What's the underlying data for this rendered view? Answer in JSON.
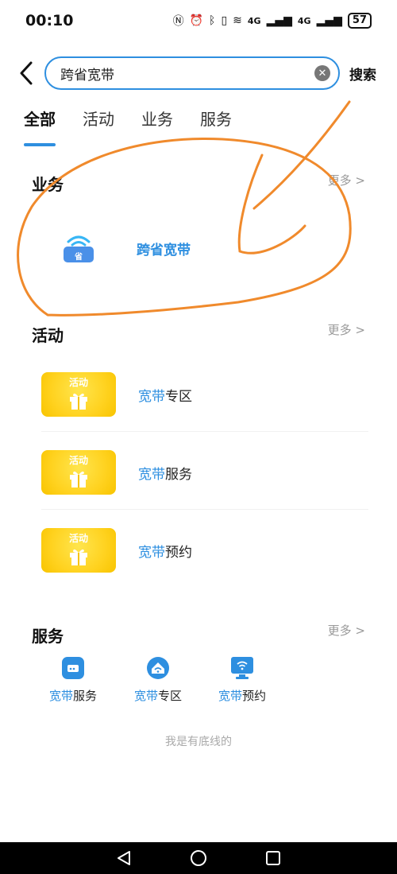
{
  "status_bar": {
    "time": "00:10",
    "signal_1": "4G",
    "signal_2": "4G",
    "battery": "57"
  },
  "search": {
    "query": "跨省宽带",
    "submit_label": "搜索"
  },
  "tabs": [
    {
      "label": "全部",
      "active": true
    },
    {
      "label": "活动",
      "active": false
    },
    {
      "label": "业务",
      "active": false
    },
    {
      "label": "服务",
      "active": false
    }
  ],
  "business": {
    "title": "业务",
    "more": "更多 >",
    "item": {
      "label": "跨省宽带",
      "icon_text": "省",
      "icon": "wifi-card-icon"
    }
  },
  "activities": {
    "title": "活动",
    "more": "更多 >",
    "tag": "活动",
    "items": [
      {
        "highlight": "宽带",
        "rest": "专区"
      },
      {
        "highlight": "宽带",
        "rest": "服务"
      },
      {
        "highlight": "宽带",
        "rest": "预约"
      }
    ]
  },
  "services": {
    "title": "服务",
    "more": "更多 >",
    "items": [
      {
        "highlight": "宽带",
        "rest": "服务",
        "icon": "router-icon"
      },
      {
        "highlight": "宽带",
        "rest": "专区",
        "icon": "home-wifi-icon"
      },
      {
        "highlight": "宽带",
        "rest": "预约",
        "icon": "monitor-wifi-icon"
      }
    ]
  },
  "footer_note": "我是有底线的",
  "colors": {
    "accent": "#2e8fe0",
    "annotation": "#f08a2c",
    "activity_yellow": "#ffd21f"
  }
}
